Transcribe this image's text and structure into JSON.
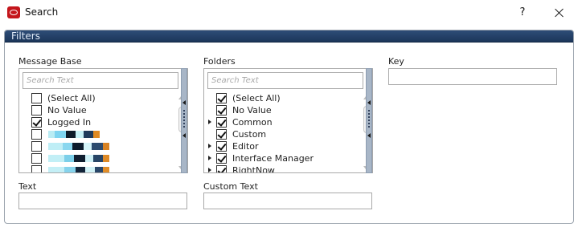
{
  "window": {
    "title": "Search",
    "help_label": "?"
  },
  "panel": {
    "header": "Filters"
  },
  "message_base": {
    "label": "Message Base",
    "search_placeholder": "Search Text",
    "items": [
      {
        "label": "(Select All)",
        "checked": false
      },
      {
        "label": "No Value",
        "checked": false
      },
      {
        "label": "Logged In",
        "checked": true
      },
      {
        "label": "",
        "checked": false,
        "redacted": true
      },
      {
        "label": "",
        "checked": false,
        "redacted": true
      },
      {
        "label": "",
        "checked": false,
        "redacted": true
      },
      {
        "label": "",
        "checked": false,
        "redacted": true
      }
    ]
  },
  "folders": {
    "label": "Folders",
    "search_placeholder": "Search Text",
    "items": [
      {
        "label": "(Select All)",
        "checked": true,
        "expandable": false
      },
      {
        "label": "No Value",
        "checked": true,
        "expandable": false
      },
      {
        "label": "Common",
        "checked": true,
        "expandable": true
      },
      {
        "label": "Custom",
        "checked": true,
        "expandable": false
      },
      {
        "label": "Editor",
        "checked": true,
        "expandable": true
      },
      {
        "label": "Interface Manager",
        "checked": true,
        "expandable": true
      },
      {
        "label": "RightNow",
        "checked": true,
        "expandable": true
      }
    ]
  },
  "key": {
    "label": "Key",
    "value": ""
  },
  "text": {
    "label": "Text",
    "value": ""
  },
  "custom_text": {
    "label": "Custom Text",
    "value": ""
  },
  "colors": {
    "header_bg": "#1c365a",
    "app_icon": "#c4161c",
    "splitter": "#a8b6c7"
  }
}
